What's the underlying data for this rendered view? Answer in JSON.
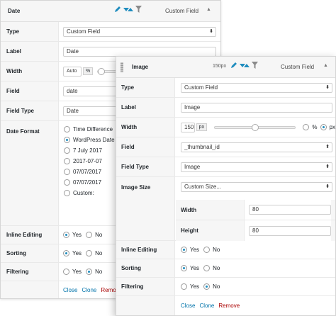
{
  "back": {
    "header": {
      "title": "Date",
      "column_type": "Custom Field"
    },
    "type": {
      "label": "Type",
      "value": "Custom Field"
    },
    "label": {
      "label": "Label",
      "value": "Date"
    },
    "width": {
      "label": "Width",
      "value": "Auto",
      "unit": "%"
    },
    "field": {
      "label": "Field",
      "value": "date"
    },
    "field_type": {
      "label": "Field Type",
      "value": "Date"
    },
    "date_format": {
      "label": "Date Format",
      "options": [
        "Time Difference",
        "WordPress Date",
        "7 July 2017",
        "2017-07-07",
        "07/07/2017",
        "07/07/2017",
        "Custom:"
      ],
      "selected_index": 1
    },
    "inline_editing": {
      "label": "Inline Editing",
      "yes": "Yes",
      "no": "No",
      "selected": "yes"
    },
    "sorting": {
      "label": "Sorting",
      "yes": "Yes",
      "no": "No",
      "selected": "yes"
    },
    "filtering": {
      "label": "Filtering",
      "yes": "Yes",
      "no": "No",
      "selected": "no"
    },
    "actions": {
      "close": "Close",
      "clone": "Clone",
      "remove": "Remove"
    }
  },
  "front": {
    "header": {
      "title": "Image",
      "width_info": "150px",
      "column_type": "Custom Field"
    },
    "type": {
      "label": "Type",
      "value": "Custom Field"
    },
    "label": {
      "label": "Label",
      "value": "Image"
    },
    "width": {
      "label": "Width",
      "value": "150",
      "unit": "px",
      "percent": "%",
      "px": "px",
      "selected_unit": "px",
      "slider_level": 0.5
    },
    "field": {
      "label": "Field",
      "value": "_thumbnail_id"
    },
    "field_type": {
      "label": "Field Type",
      "value": "Image"
    },
    "image_size": {
      "label": "Image Size",
      "value": "Custom Size...",
      "width_label": "Width",
      "width_value": "80",
      "height_label": "Height",
      "height_value": "80"
    },
    "inline_editing": {
      "label": "Inline Editing",
      "yes": "Yes",
      "no": "No",
      "selected": "yes"
    },
    "sorting": {
      "label": "Sorting",
      "yes": "Yes",
      "no": "No",
      "selected": "yes"
    },
    "filtering": {
      "label": "Filtering",
      "yes": "Yes",
      "no": "No",
      "selected": "no"
    },
    "actions": {
      "close": "Close",
      "clone": "Clone",
      "remove": "Remove"
    }
  },
  "colors": {
    "accent": "#1e8cbe",
    "link": "#0073aa",
    "remove": "#aa0000"
  },
  "icons": [
    "pencil-icon",
    "sort-icon",
    "filter-icon",
    "chevron-up-icon",
    "drag-handle-icon"
  ]
}
